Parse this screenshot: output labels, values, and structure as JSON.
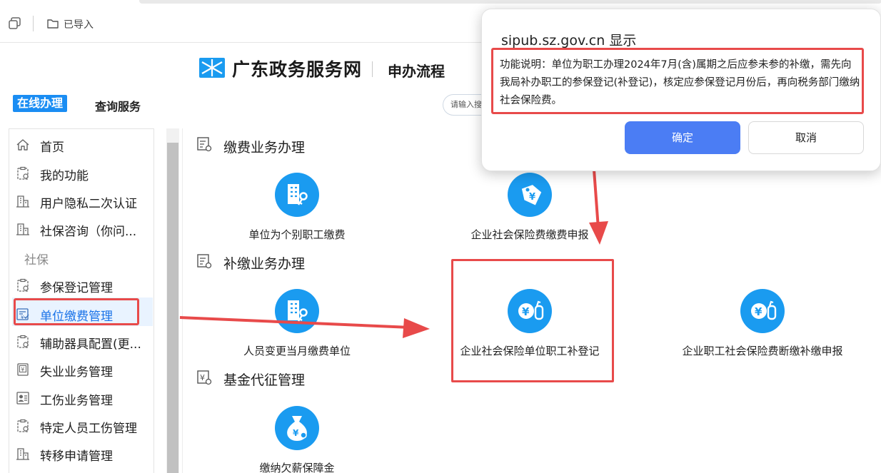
{
  "browser": {
    "bookmark_label": "已导入"
  },
  "header": {
    "site_name": "广东政务服务网",
    "subtitle": "申办流程"
  },
  "nav": {
    "tab_online": "在线办理",
    "tab_query": "查询服务",
    "search_placeholder": "请输入搜"
  },
  "sidebar": {
    "items": [
      {
        "label": "首页",
        "icon": "home-icon"
      },
      {
        "label": "我的功能",
        "icon": "clipboard-icon"
      },
      {
        "label": "用户隐私二次认证",
        "icon": "building-icon"
      },
      {
        "label": "社保咨询（你问...",
        "icon": "building-icon"
      },
      {
        "label": "参保登记管理",
        "icon": "clipboard-icon"
      },
      {
        "label": "单位缴费管理",
        "icon": "payment-form-icon"
      },
      {
        "label": "辅助器具配置(更...",
        "icon": "clipboard-icon"
      },
      {
        "label": "失业业务管理",
        "icon": "yen-document-icon"
      },
      {
        "label": "工伤业务管理",
        "icon": "id-card-icon"
      },
      {
        "label": "特定人员工伤管理",
        "icon": "clipboard-icon"
      },
      {
        "label": "转移申请管理",
        "icon": "building-icon"
      }
    ],
    "section_label": "社保"
  },
  "content": {
    "sections": [
      {
        "title": "缴费业务办理"
      },
      {
        "title": "补缴业务办理"
      },
      {
        "title": "基金代征管理"
      }
    ],
    "services": [
      {
        "label": "单位为个别职工缴费",
        "icon": "building-key-icon"
      },
      {
        "label": "企业社会保险费缴费申报",
        "icon": "yen-tag-icon"
      },
      {
        "label": "人员变更当月缴费单位",
        "icon": "building-key-icon"
      },
      {
        "label": "企业社会保险单位职工补登记",
        "icon": "yen-bottle-icon"
      },
      {
        "label": "企业职工社会保险费断缴补缴申报",
        "icon": "yen-bottle-icon"
      },
      {
        "label": "缴纳欠薪保障金",
        "icon": "money-bag-icon"
      }
    ]
  },
  "dialog": {
    "title": "sipub.sz.gov.cn 显示",
    "message": "功能说明：单位为职工办理2024年7月(含)属期之后应参未参的补缴，需先向我局补办职工的参保登记(补登记)，核定应参保登记月份后，再向税务部门缴纳社会保险费。",
    "ok_label": "确定",
    "cancel_label": "取消"
  },
  "colors": {
    "accent": "#1a8df3",
    "icon_blue": "#1a9bf0",
    "highlight_red": "#e84a4a",
    "button_blue": "#4b7df4"
  }
}
